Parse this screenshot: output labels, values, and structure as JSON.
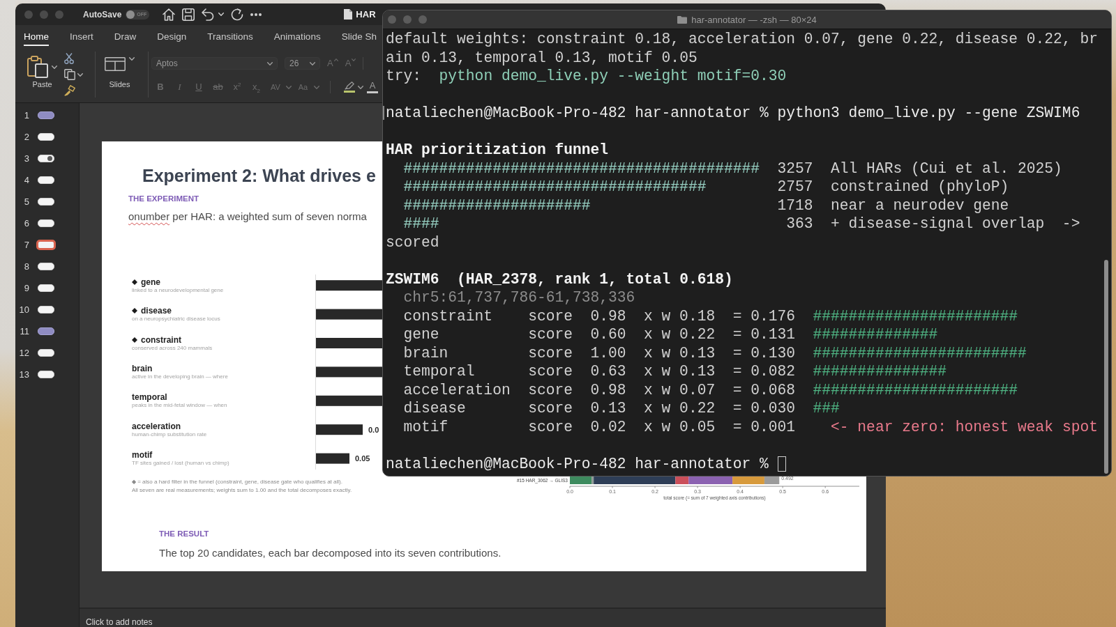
{
  "powerpoint": {
    "title_bar": {
      "autosave_label": "AutoSave",
      "autosave_toggle": {
        "on": false,
        "label": "OFF"
      },
      "document_title": "HAR"
    },
    "ribbon_tabs": [
      {
        "label": "Home",
        "selected": true
      },
      {
        "label": "Insert",
        "selected": false
      },
      {
        "label": "Draw",
        "selected": false
      },
      {
        "label": "Design",
        "selected": false
      },
      {
        "label": "Transitions",
        "selected": false
      },
      {
        "label": "Animations",
        "selected": false
      },
      {
        "label": "Slide Sh",
        "selected": false
      }
    ],
    "clipboard": {
      "paste_label": "Paste"
    },
    "slides_group": {
      "label": "Slides"
    },
    "font": {
      "name": "Aptos",
      "size": "26",
      "size_buttons": [
        {
          "kind": "grow",
          "label": "A",
          "disabled": true
        },
        {
          "kind": "shrink",
          "label": "A",
          "disabled": true
        }
      ]
    },
    "format_buttons": [
      {
        "kind": "bold",
        "label": "B",
        "disabled": true,
        "dropdown": false
      },
      {
        "kind": "italic",
        "label": "I",
        "disabled": true,
        "dropdown": false
      },
      {
        "kind": "underline",
        "label": "U",
        "disabled": true,
        "dropdown": false
      },
      {
        "kind": "strike",
        "label": "ab",
        "disabled": true,
        "dropdown": false
      },
      {
        "kind": "superscript",
        "label": "x$^{2}$",
        "disabled": true,
        "dropdown": false
      },
      {
        "kind": "subscript",
        "label": "x$_{2}$",
        "disabled": true,
        "dropdown": false
      },
      {
        "kind": "spacing",
        "label": "AV",
        "disabled": true,
        "dropdown": true
      },
      {
        "kind": "case",
        "label": "Aa",
        "disabled": true,
        "dropdown": true
      }
    ],
    "color_buttons": [
      {
        "kind": "highlight",
        "color": "#b9c46c",
        "dropdown": true
      },
      {
        "kind": "font_color",
        "label": "A",
        "color": "#c8c8c8",
        "dropdown": false
      }
    ],
    "slide_thumbnails": [
      {
        "number": "1",
        "kind": "title",
        "selected": false
      },
      {
        "number": "2",
        "kind": "content",
        "selected": false
      },
      {
        "number": "3",
        "kind": "diagram",
        "selected": false
      },
      {
        "number": "4",
        "kind": "content",
        "selected": false
      },
      {
        "number": "5",
        "kind": "content",
        "selected": false
      },
      {
        "number": "6",
        "kind": "content",
        "selected": false
      },
      {
        "number": "7",
        "kind": "content",
        "selected": true
      },
      {
        "number": "8",
        "kind": "content",
        "selected": false
      },
      {
        "number": "9",
        "kind": "content",
        "selected": false
      },
      {
        "number": "10",
        "kind": "content",
        "selected": false
      },
      {
        "number": "11",
        "kind": "title",
        "selected": false
      },
      {
        "number": "12",
        "kind": "content",
        "selected": false
      },
      {
        "number": "13",
        "kind": "content",
        "selected": false
      }
    ],
    "slide": {
      "title": "Experiment 2: What drives e",
      "section_label": "THE EXPERIMENT",
      "intro": [
        {
          "text": "onumber",
          "misspelled": true
        },
        {
          "text": " per HAR: a weighted sum of seven norma",
          "misspelled": false
        }
      ],
      "weights_chart": {
        "rows": [
          {
            "label": "gene",
            "note": "linked to a neurodevelopmental gene",
            "hard_filter": true
          },
          {
            "label": "disease",
            "note": "on a neuropsychiatric disease locus",
            "hard_filter": true
          },
          {
            "label": "constraint",
            "note": "conserved across 240 mammals",
            "hard_filter": true
          },
          {
            "label": "brain",
            "note": "active in the developing brain — where",
            "hard_filter": false
          },
          {
            "label": "temporal",
            "note": "peaks in the mid-fetal window — when",
            "hard_filter": false
          },
          {
            "label": "acceleration",
            "note": "human-chimp substitution rate",
            "hard_filter": false,
            "value_label": "0.0"
          },
          {
            "label": "motif",
            "note": "TF sites gained / lost (human vs chimp)",
            "hard_filter": false,
            "value_label": "0.05"
          }
        ]
      },
      "footnotes": [
        "◆ = also a hard filter in the funnel (constraint, gene, disease gate who qualifies at all).",
        "All seven are real measurements; weights sum to 1.00 and the total decomposes exactly."
      ],
      "contribution_chart": {
        "chart_data": {
          "type": "bar",
          "orientation": "horizontal",
          "stacked": true,
          "categories": [
            "#15 HAR_3062 → GLIS3"
          ],
          "series": [
            {
              "color": "#3e8b5f",
              "values": [
                0.051
              ]
            },
            {
              "color": "#8f9a96",
              "values": [
                0.005
              ]
            },
            {
              "color": "#2e3e57",
              "values": [
                0.192
              ]
            },
            {
              "color": "#cb4f5a",
              "values": [
                0.031
              ]
            },
            {
              "color": "#8b62b1",
              "values": [
                0.103
              ]
            },
            {
              "color": "#d79a3c",
              "values": [
                0.075
              ]
            },
            {
              "color": "#9b9b9b",
              "values": [
                0.035
              ]
            }
          ],
          "value_labels": [
            "0.492"
          ],
          "xlim": [
            0,
            0.68
          ],
          "xticks": [
            {
              "value": 0,
              "label": "0.0"
            },
            {
              "value": 0.1,
              "label": "0.1"
            },
            {
              "value": 0.2,
              "label": "0.2"
            },
            {
              "value": 0.3,
              "label": "0.3"
            },
            {
              "value": 0.4,
              "label": "0.4"
            },
            {
              "value": 0.5,
              "label": "0.5"
            },
            {
              "value": 0.6,
              "label": "0.6"
            }
          ],
          "xlabel": "total score (= sum of 7 weighted axis contributions)"
        }
      },
      "result_label": "THE RESULT",
      "result_text": "The top 20 candidates, each bar decomposed into its seven contributions."
    },
    "notes_placeholder": "Click to add notes"
  },
  "terminal": {
    "title": "har-annotator — -zsh — 80×24",
    "blocks": [
      {
        "marked": false,
        "cursor": false,
        "lines": [
          {
            "segments": [
              {
                "kind": "plain",
                "text": "default weights: constraint 0.18, acceleration 0.07, gene 0.22, disease 0.22, br"
              }
            ]
          },
          {
            "segments": [
              {
                "kind": "plain",
                "text": "ain 0.13, temporal 0.13, motif 0.05"
              }
            ]
          },
          {
            "segments": [
              {
                "kind": "plain",
                "text": "try:  "
              },
              {
                "kind": "command",
                "text": "python demo_live.py --weight motif=0.30"
              }
            ]
          }
        ]
      },
      {
        "marked": true,
        "cursor": false,
        "lines": [
          {
            "segments": [
              {
                "kind": "prompt",
                "text": "nataliechen@MacBook-Pro-482 har-annotator % python3 demo_live.py --gene ZSWIM6"
              }
            ]
          }
        ]
      },
      {
        "marked": false,
        "cursor": false,
        "lines": [
          {
            "segments": [
              {
                "kind": "bold",
                "text": "HAR prioritization funnel"
              }
            ]
          },
          {
            "segments": [
              {
                "kind": "funnel_bar",
                "text": "  ########################################"
              },
              {
                "kind": "plain",
                "text": "  3257  All HARs (Cui et al. 2025)"
              }
            ]
          },
          {
            "segments": [
              {
                "kind": "funnel_bar",
                "text": "  ##################################"
              },
              {
                "kind": "plain",
                "text": "        2757  constrained (phyloP)"
              }
            ]
          },
          {
            "segments": [
              {
                "kind": "funnel_bar",
                "text": "  #####################"
              },
              {
                "kind": "plain",
                "text": "                     1718  near a neurodev gene"
              }
            ]
          },
          {
            "segments": [
              {
                "kind": "funnel_bar",
                "text": "  ####"
              },
              {
                "kind": "plain",
                "text": "                                       363  + disease-signal overlap  ->"
              }
            ]
          },
          {
            "segments": [
              {
                "kind": "plain",
                "text": "scored"
              }
            ]
          }
        ]
      },
      {
        "marked": false,
        "cursor": false,
        "lines": [
          {
            "segments": [
              {
                "kind": "bold",
                "text": "ZSWIM6  (HAR_2378, rank 1, total 0.618)"
              }
            ]
          },
          {
            "segments": [
              {
                "kind": "dim",
                "text": "  chr5:61,737,786-61,738,336"
              }
            ]
          },
          {
            "segments": [
              {
                "kind": "plain",
                "text": "  constraint    score  0.98  x w 0.18  = 0.176  "
              },
              {
                "kind": "score_bar",
                "text": "#######################"
              }
            ]
          },
          {
            "segments": [
              {
                "kind": "plain",
                "text": "  gene          score  0.60  x w 0.22  = 0.131  "
              },
              {
                "kind": "score_bar",
                "text": "##############"
              }
            ]
          },
          {
            "segments": [
              {
                "kind": "plain",
                "text": "  brain         score  1.00  x w 0.13  = 0.130  "
              },
              {
                "kind": "score_bar",
                "text": "########################"
              }
            ]
          },
          {
            "segments": [
              {
                "kind": "plain",
                "text": "  temporal      score  0.63  x w 0.13  = 0.082  "
              },
              {
                "kind": "score_bar",
                "text": "###############"
              }
            ]
          },
          {
            "segments": [
              {
                "kind": "plain",
                "text": "  acceleration  score  0.98  x w 0.07  = 0.068  "
              },
              {
                "kind": "score_bar",
                "text": "#######################"
              }
            ]
          },
          {
            "segments": [
              {
                "kind": "plain",
                "text": "  disease       score  0.13  x w 0.22  = 0.030  "
              },
              {
                "kind": "score_bar",
                "text": "###"
              }
            ]
          },
          {
            "segments": [
              {
                "kind": "plain",
                "text": "  motif         score  0.02  x w 0.05  = 0.001    "
              },
              {
                "kind": "warning",
                "text": "<- near zero: honest weak spot"
              }
            ]
          }
        ]
      },
      {
        "marked": false,
        "cursor": true,
        "lines": [
          {
            "segments": [
              {
                "kind": "prompt",
                "text": "nataliechen@MacBook-Pro-482 har-annotator %"
              }
            ]
          }
        ]
      }
    ]
  }
}
